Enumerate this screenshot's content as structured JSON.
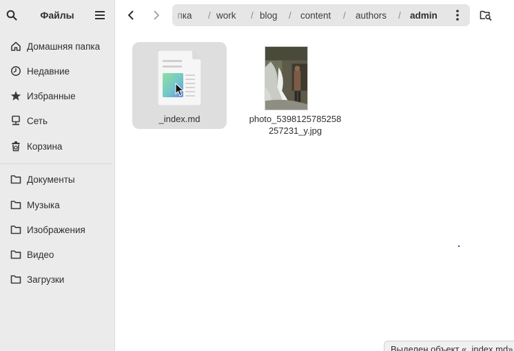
{
  "sidebar": {
    "title": "Файлы",
    "places": [
      {
        "label": "Домашняя папка",
        "icon": "home-icon"
      },
      {
        "label": "Недавние",
        "icon": "clock-icon"
      },
      {
        "label": "Избранные",
        "icon": "star-icon"
      },
      {
        "label": "Сеть",
        "icon": "network-icon"
      },
      {
        "label": "Корзина",
        "icon": "trash-icon"
      }
    ],
    "bookmarks": [
      {
        "label": "Документы",
        "icon": "folder-icon"
      },
      {
        "label": "Музыка",
        "icon": "folder-icon"
      },
      {
        "label": "Изображения",
        "icon": "folder-icon"
      },
      {
        "label": "Видео",
        "icon": "folder-icon"
      },
      {
        "label": "Загрузки",
        "icon": "folder-icon"
      }
    ]
  },
  "pathbar": {
    "crumbs": [
      ". пка",
      "work",
      "blog",
      "content",
      "authors",
      "admin"
    ],
    "separator": "/"
  },
  "files": [
    {
      "name": "_index.md",
      "type": "markdown-document",
      "selected": true
    },
    {
      "name": "photo_5398125785258257231_y.jpg",
      "type": "image"
    }
  ],
  "status": {
    "text": "Выделен объект «_index.md»"
  },
  "colors": {
    "sidebar_bg": "#ebebeb",
    "selection_bg": "#dedede",
    "pathbar_bg": "#e6e6e6"
  }
}
